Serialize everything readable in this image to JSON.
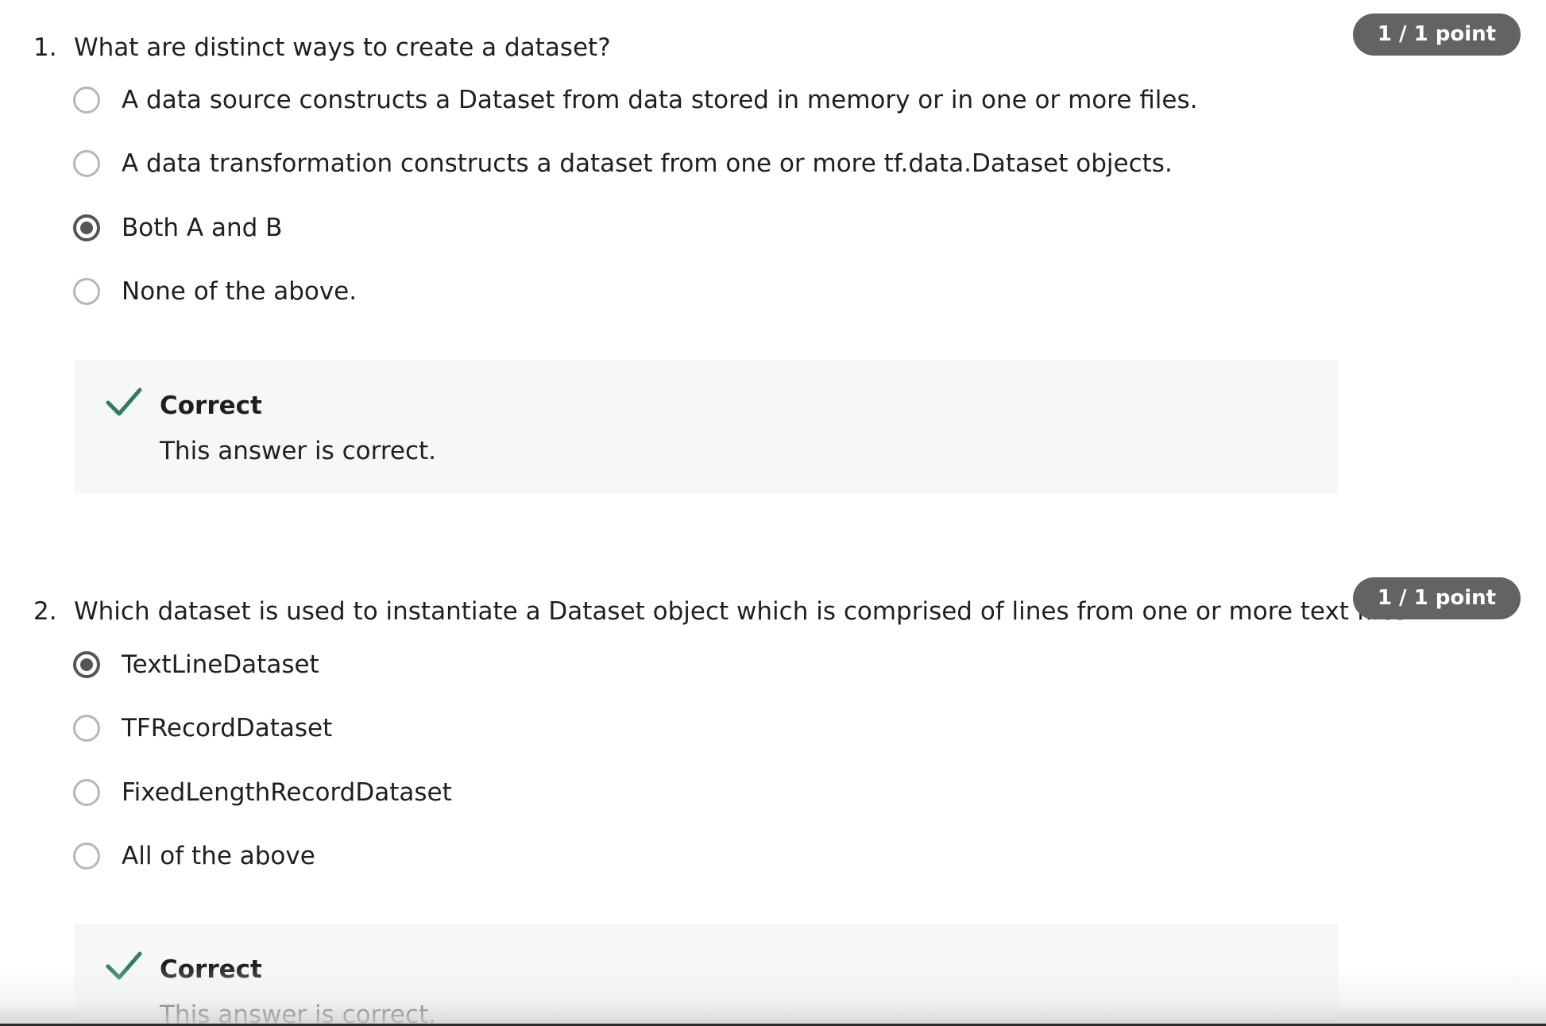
{
  "questions": [
    {
      "number": "1.",
      "text": "What are distinct ways to create a dataset?",
      "points": "1 / 1 point",
      "options": [
        {
          "label": "A data source constructs a Dataset from data stored in memory or in one or more files.",
          "selected": false
        },
        {
          "label": "A data transformation constructs a dataset from one or more tf.data.Dataset objects.",
          "selected": false
        },
        {
          "label": "Both A and B",
          "selected": true
        },
        {
          "label": "None of the above.",
          "selected": false
        }
      ],
      "feedback": {
        "title": "Correct",
        "text": "This answer is correct."
      }
    },
    {
      "number": "2.",
      "text": "Which dataset is used to instantiate a Dataset object which is comprised of lines from one or more text files?",
      "points": "1 / 1 point",
      "options": [
        {
          "label": "TextLineDataset",
          "selected": true
        },
        {
          "label": "TFRecordDataset",
          "selected": false
        },
        {
          "label": "FixedLengthRecordDataset",
          "selected": false
        },
        {
          "label": "All of the above",
          "selected": false
        }
      ],
      "feedback": {
        "title": "Correct",
        "text": "This answer is correct."
      }
    }
  ],
  "icons": {
    "correct": "checkmark-icon",
    "radio_selected": "radio-selected-icon",
    "radio_unselected": "radio-unselected-icon"
  },
  "colors": {
    "check_green": "#2f7d5b",
    "badge_bg": "#636363",
    "feedback_bg": "#f6f8f7",
    "radio_selected": "#555555",
    "radio_unselected": "#b7b7b7"
  }
}
